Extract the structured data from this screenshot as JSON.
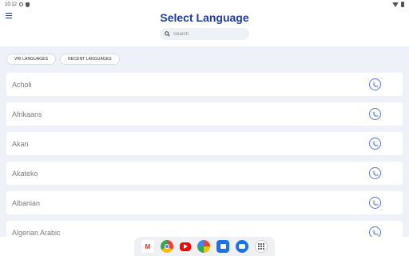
{
  "status_bar": {
    "time": "10:12"
  },
  "header": {
    "title": "Select Language"
  },
  "search": {
    "placeholder": "Search"
  },
  "filters": [
    {
      "label": "VRI LANGUAGES"
    },
    {
      "label": "RECENT LANGUAGES"
    }
  ],
  "languages": [
    {
      "name": "Acholi"
    },
    {
      "name": "Afrikaans"
    },
    {
      "name": "Akan"
    },
    {
      "name": "Akateko"
    },
    {
      "name": "Albanian"
    },
    {
      "name": "Algerian Arabic"
    }
  ],
  "colors": {
    "accent": "#1f3aa8",
    "background": "#eef2f8",
    "call_icon": "#5b78c9"
  },
  "dock_apps": [
    {
      "icon": "gmail-icon"
    },
    {
      "icon": "chrome-icon"
    },
    {
      "icon": "youtube-icon"
    },
    {
      "icon": "photos-icon"
    },
    {
      "icon": "files-icon"
    },
    {
      "icon": "messages-icon"
    },
    {
      "icon": "app-drawer-icon"
    }
  ]
}
